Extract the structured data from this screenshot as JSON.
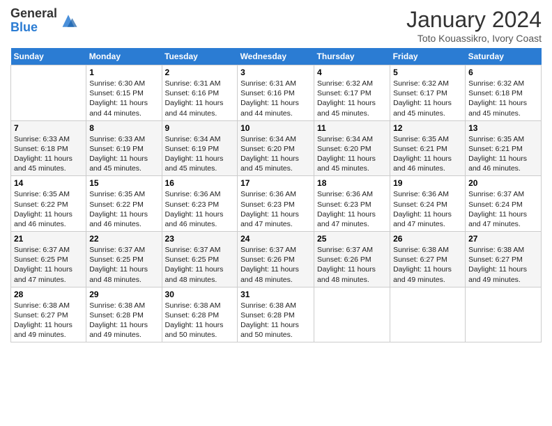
{
  "header": {
    "logo_general": "General",
    "logo_blue": "Blue",
    "month_title": "January 2024",
    "location": "Toto Kouassikro, Ivory Coast"
  },
  "weekdays": [
    "Sunday",
    "Monday",
    "Tuesday",
    "Wednesday",
    "Thursday",
    "Friday",
    "Saturday"
  ],
  "weeks": [
    [
      {
        "day": "",
        "content": ""
      },
      {
        "day": "1",
        "content": "Sunrise: 6:30 AM\nSunset: 6:15 PM\nDaylight: 11 hours\nand 44 minutes."
      },
      {
        "day": "2",
        "content": "Sunrise: 6:31 AM\nSunset: 6:16 PM\nDaylight: 11 hours\nand 44 minutes."
      },
      {
        "day": "3",
        "content": "Sunrise: 6:31 AM\nSunset: 6:16 PM\nDaylight: 11 hours\nand 44 minutes."
      },
      {
        "day": "4",
        "content": "Sunrise: 6:32 AM\nSunset: 6:17 PM\nDaylight: 11 hours\nand 45 minutes."
      },
      {
        "day": "5",
        "content": "Sunrise: 6:32 AM\nSunset: 6:17 PM\nDaylight: 11 hours\nand 45 minutes."
      },
      {
        "day": "6",
        "content": "Sunrise: 6:32 AM\nSunset: 6:18 PM\nDaylight: 11 hours\nand 45 minutes."
      }
    ],
    [
      {
        "day": "7",
        "content": "Sunrise: 6:33 AM\nSunset: 6:18 PM\nDaylight: 11 hours\nand 45 minutes."
      },
      {
        "day": "8",
        "content": "Sunrise: 6:33 AM\nSunset: 6:19 PM\nDaylight: 11 hours\nand 45 minutes."
      },
      {
        "day": "9",
        "content": "Sunrise: 6:34 AM\nSunset: 6:19 PM\nDaylight: 11 hours\nand 45 minutes."
      },
      {
        "day": "10",
        "content": "Sunrise: 6:34 AM\nSunset: 6:20 PM\nDaylight: 11 hours\nand 45 minutes."
      },
      {
        "day": "11",
        "content": "Sunrise: 6:34 AM\nSunset: 6:20 PM\nDaylight: 11 hours\nand 45 minutes."
      },
      {
        "day": "12",
        "content": "Sunrise: 6:35 AM\nSunset: 6:21 PM\nDaylight: 11 hours\nand 46 minutes."
      },
      {
        "day": "13",
        "content": "Sunrise: 6:35 AM\nSunset: 6:21 PM\nDaylight: 11 hours\nand 46 minutes."
      }
    ],
    [
      {
        "day": "14",
        "content": "Sunrise: 6:35 AM\nSunset: 6:22 PM\nDaylight: 11 hours\nand 46 minutes."
      },
      {
        "day": "15",
        "content": "Sunrise: 6:35 AM\nSunset: 6:22 PM\nDaylight: 11 hours\nand 46 minutes."
      },
      {
        "day": "16",
        "content": "Sunrise: 6:36 AM\nSunset: 6:23 PM\nDaylight: 11 hours\nand 46 minutes."
      },
      {
        "day": "17",
        "content": "Sunrise: 6:36 AM\nSunset: 6:23 PM\nDaylight: 11 hours\nand 47 minutes."
      },
      {
        "day": "18",
        "content": "Sunrise: 6:36 AM\nSunset: 6:23 PM\nDaylight: 11 hours\nand 47 minutes."
      },
      {
        "day": "19",
        "content": "Sunrise: 6:36 AM\nSunset: 6:24 PM\nDaylight: 11 hours\nand 47 minutes."
      },
      {
        "day": "20",
        "content": "Sunrise: 6:37 AM\nSunset: 6:24 PM\nDaylight: 11 hours\nand 47 minutes."
      }
    ],
    [
      {
        "day": "21",
        "content": "Sunrise: 6:37 AM\nSunset: 6:25 PM\nDaylight: 11 hours\nand 47 minutes."
      },
      {
        "day": "22",
        "content": "Sunrise: 6:37 AM\nSunset: 6:25 PM\nDaylight: 11 hours\nand 48 minutes."
      },
      {
        "day": "23",
        "content": "Sunrise: 6:37 AM\nSunset: 6:25 PM\nDaylight: 11 hours\nand 48 minutes."
      },
      {
        "day": "24",
        "content": "Sunrise: 6:37 AM\nSunset: 6:26 PM\nDaylight: 11 hours\nand 48 minutes."
      },
      {
        "day": "25",
        "content": "Sunrise: 6:37 AM\nSunset: 6:26 PM\nDaylight: 11 hours\nand 48 minutes."
      },
      {
        "day": "26",
        "content": "Sunrise: 6:38 AM\nSunset: 6:27 PM\nDaylight: 11 hours\nand 49 minutes."
      },
      {
        "day": "27",
        "content": "Sunrise: 6:38 AM\nSunset: 6:27 PM\nDaylight: 11 hours\nand 49 minutes."
      }
    ],
    [
      {
        "day": "28",
        "content": "Sunrise: 6:38 AM\nSunset: 6:27 PM\nDaylight: 11 hours\nand 49 minutes."
      },
      {
        "day": "29",
        "content": "Sunrise: 6:38 AM\nSunset: 6:28 PM\nDaylight: 11 hours\nand 49 minutes."
      },
      {
        "day": "30",
        "content": "Sunrise: 6:38 AM\nSunset: 6:28 PM\nDaylight: 11 hours\nand 50 minutes."
      },
      {
        "day": "31",
        "content": "Sunrise: 6:38 AM\nSunset: 6:28 PM\nDaylight: 11 hours\nand 50 minutes."
      },
      {
        "day": "",
        "content": ""
      },
      {
        "day": "",
        "content": ""
      },
      {
        "day": "",
        "content": ""
      }
    ]
  ]
}
